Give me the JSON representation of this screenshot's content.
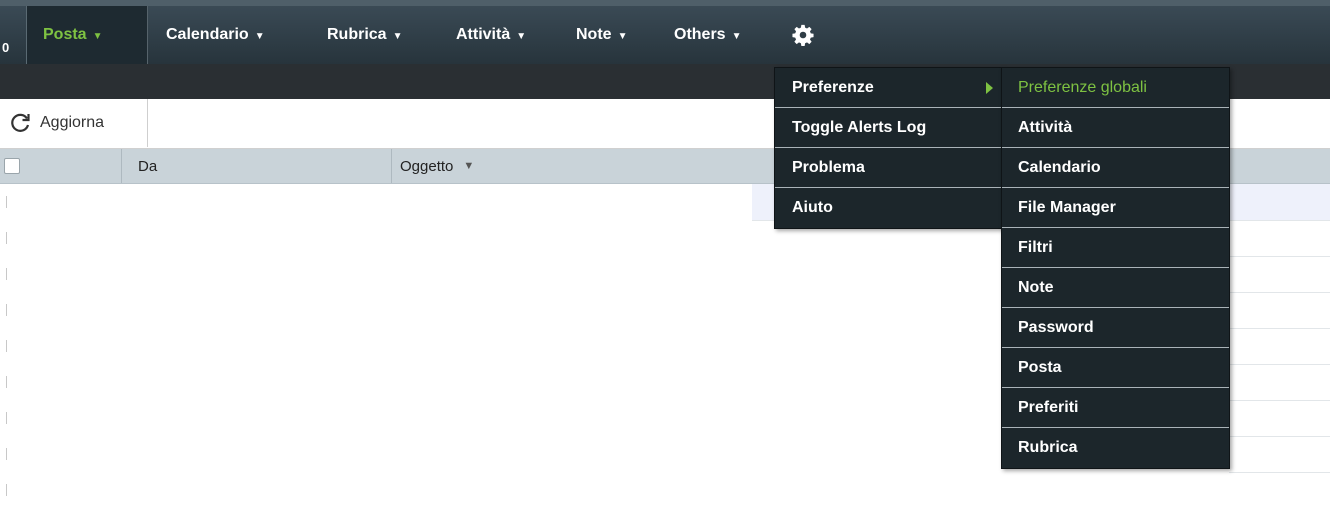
{
  "topnav": {
    "edge_glyph": "0",
    "items": [
      {
        "label": "Posta",
        "active": true
      },
      {
        "label": "Calendario"
      },
      {
        "label": "Rubrica"
      },
      {
        "label": "Attività"
      },
      {
        "label": "Note"
      },
      {
        "label": "Others"
      }
    ],
    "settings_icon": "gear-icon",
    "caret_glyph": "▼"
  },
  "toolbar": {
    "refresh_label": "Aggiorna",
    "refresh_icon": "refresh-icon"
  },
  "columns": {
    "from": "Da",
    "subject": "Oggetto",
    "sort_glyph": "▼"
  },
  "settings_menu": {
    "items": [
      {
        "label": "Preferenze",
        "has_submenu": true
      },
      {
        "label": "Toggle Alerts Log"
      },
      {
        "label": "Problema"
      },
      {
        "label": "Aiuto"
      }
    ]
  },
  "preferences_submenu": {
    "items": [
      {
        "label": "Preferenze globali",
        "highlighted": true
      },
      {
        "label": "Attività"
      },
      {
        "label": "Calendario"
      },
      {
        "label": "File Manager"
      },
      {
        "label": "Filtri"
      },
      {
        "label": "Note"
      },
      {
        "label": "Password"
      },
      {
        "label": "Posta"
      },
      {
        "label": "Preferiti"
      },
      {
        "label": "Rubrica"
      }
    ]
  },
  "colors": {
    "accent_green": "#7ec242",
    "nav_bg": "#27343c",
    "menu_bg": "#1c262b",
    "header_row": "#c9d3d9"
  }
}
